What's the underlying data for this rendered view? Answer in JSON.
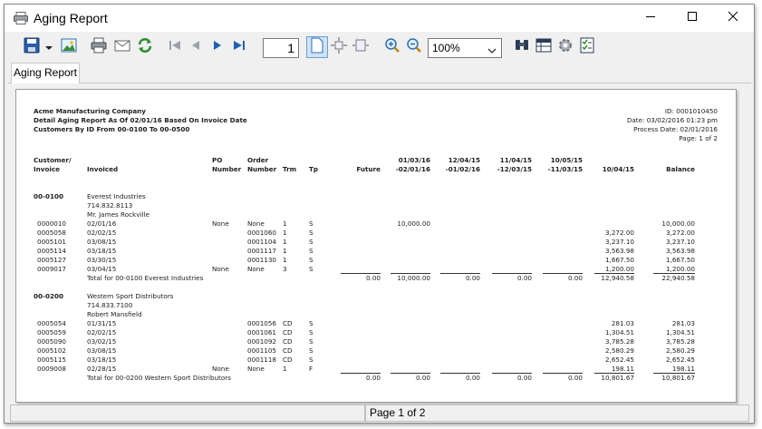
{
  "window": {
    "title": "Aging Report"
  },
  "toolbar": {
    "page_number": "1",
    "zoom": "100%"
  },
  "tabs": [
    {
      "label": "Aging Report"
    }
  ],
  "report": {
    "company": "Acme Manufacturing Company",
    "subtitle": "Detail Aging Report As Of 02/01/16 Based On Invoice Date",
    "range": "Customers By ID From 00-0100 To 00-0500",
    "id_line": "ID: 0001010450",
    "date_line": "Date: 03/02/2016 01:23 pm",
    "process_line": "Process Date: 02/01/2016",
    "page_line": "Page: 1 of 2",
    "columns": {
      "cust_1": "Customer/",
      "cust_2": "Invoice",
      "invoiced": "Invoiced",
      "po_1": "PO",
      "po_2": "Number",
      "order_1": "Order",
      "order_2": "Number",
      "trm": "Trm",
      "tp": "Tp",
      "future": "Future",
      "b1_1": "01/03/16",
      "b1_2": "-02/01/16",
      "b2_1": "12/04/15",
      "b2_2": "-01/02/16",
      "b3_1": "11/04/15",
      "b3_2": "-12/03/15",
      "b4_1": "10/05/15",
      "b4_2": "-11/03/15",
      "b5": "10/04/15",
      "balance": "Balance"
    },
    "groups": [
      {
        "id": "00-0100",
        "name": "Everest Industries",
        "phone": "714.832.8113",
        "contact": "Mr. James Rockville",
        "rows": [
          {
            "inv": "0000010",
            "date": "02/01/16",
            "po": "None",
            "order": "None",
            "trm": "1",
            "tp": "S",
            "future": "",
            "b1": "10,000.00",
            "b2": "",
            "b3": "",
            "b4": "",
            "b5": "",
            "balance": "10,000.00"
          },
          {
            "inv": "0005058",
            "date": "02/02/15",
            "po": "",
            "order": "0001060",
            "trm": "1",
            "tp": "S",
            "future": "",
            "b1": "",
            "b2": "",
            "b3": "",
            "b4": "",
            "b5": "3,272.00",
            "balance": "3,272.00"
          },
          {
            "inv": "0005101",
            "date": "03/08/15",
            "po": "",
            "order": "0001104",
            "trm": "1",
            "tp": "S",
            "future": "",
            "b1": "",
            "b2": "",
            "b3": "",
            "b4": "",
            "b5": "3,237.10",
            "balance": "3,237.10"
          },
          {
            "inv": "0005114",
            "date": "03/18/15",
            "po": "",
            "order": "0001117",
            "trm": "1",
            "tp": "S",
            "future": "",
            "b1": "",
            "b2": "",
            "b3": "",
            "b4": "",
            "b5": "3,563.98",
            "balance": "3,563.98"
          },
          {
            "inv": "0005127",
            "date": "03/30/15",
            "po": "",
            "order": "0001130",
            "trm": "1",
            "tp": "S",
            "future": "",
            "b1": "",
            "b2": "",
            "b3": "",
            "b4": "",
            "b5": "1,667.50",
            "balance": "1,667.50"
          },
          {
            "inv": "0009017",
            "date": "03/04/15",
            "po": "None",
            "order": "None",
            "trm": "3",
            "tp": "S",
            "future": "",
            "b1": "",
            "b2": "",
            "b3": "",
            "b4": "",
            "b5": "1,200.00",
            "balance": "1,200.00"
          }
        ],
        "total": {
          "label": "Total for 00-0100 Everest Industries",
          "future": "0.00",
          "b1": "10,000.00",
          "b2": "0.00",
          "b3": "0.00",
          "b4": "0.00",
          "b5": "12,940.58",
          "balance": "22,940.58"
        }
      },
      {
        "id": "00-0200",
        "name": "Western Sport Distributors",
        "phone": "714.833.7100",
        "contact": "Robert Mansfield",
        "rows": [
          {
            "inv": "0005054",
            "date": "01/31/15",
            "po": "",
            "order": "0001056",
            "trm": "CD",
            "tp": "S",
            "future": "",
            "b1": "",
            "b2": "",
            "b3": "",
            "b4": "",
            "b5": "281.03",
            "balance": "281.03"
          },
          {
            "inv": "0005059",
            "date": "02/02/15",
            "po": "",
            "order": "0001061",
            "trm": "CD",
            "tp": "S",
            "future": "",
            "b1": "",
            "b2": "",
            "b3": "",
            "b4": "",
            "b5": "1,304.51",
            "balance": "1,304.51"
          },
          {
            "inv": "0005090",
            "date": "03/02/15",
            "po": "",
            "order": "0001092",
            "trm": "CD",
            "tp": "S",
            "future": "",
            "b1": "",
            "b2": "",
            "b3": "",
            "b4": "",
            "b5": "3,785.28",
            "balance": "3,785.28"
          },
          {
            "inv": "0005102",
            "date": "03/08/15",
            "po": "",
            "order": "0001105",
            "trm": "CD",
            "tp": "S",
            "future": "",
            "b1": "",
            "b2": "",
            "b3": "",
            "b4": "",
            "b5": "2,580.29",
            "balance": "2,580.29"
          },
          {
            "inv": "0005115",
            "date": "03/18/15",
            "po": "",
            "order": "0001118",
            "trm": "CD",
            "tp": "S",
            "future": "",
            "b1": "",
            "b2": "",
            "b3": "",
            "b4": "",
            "b5": "2,652.45",
            "balance": "2,652.45"
          },
          {
            "inv": "0009008",
            "date": "02/28/15",
            "po": "None",
            "order": "None",
            "trm": "1",
            "tp": "F",
            "future": "",
            "b1": "",
            "b2": "",
            "b3": "",
            "b4": "",
            "b5": "198.11",
            "balance": "198.11"
          }
        ],
        "total": {
          "label": "Total for 00-0200 Western Sport Distributors",
          "future": "0.00",
          "b1": "0.00",
          "b2": "0.00",
          "b3": "0.00",
          "b4": "0.00",
          "b5": "10,801.67",
          "balance": "10,801.67"
        }
      }
    ]
  },
  "status": {
    "page": "Page 1 of 2"
  }
}
